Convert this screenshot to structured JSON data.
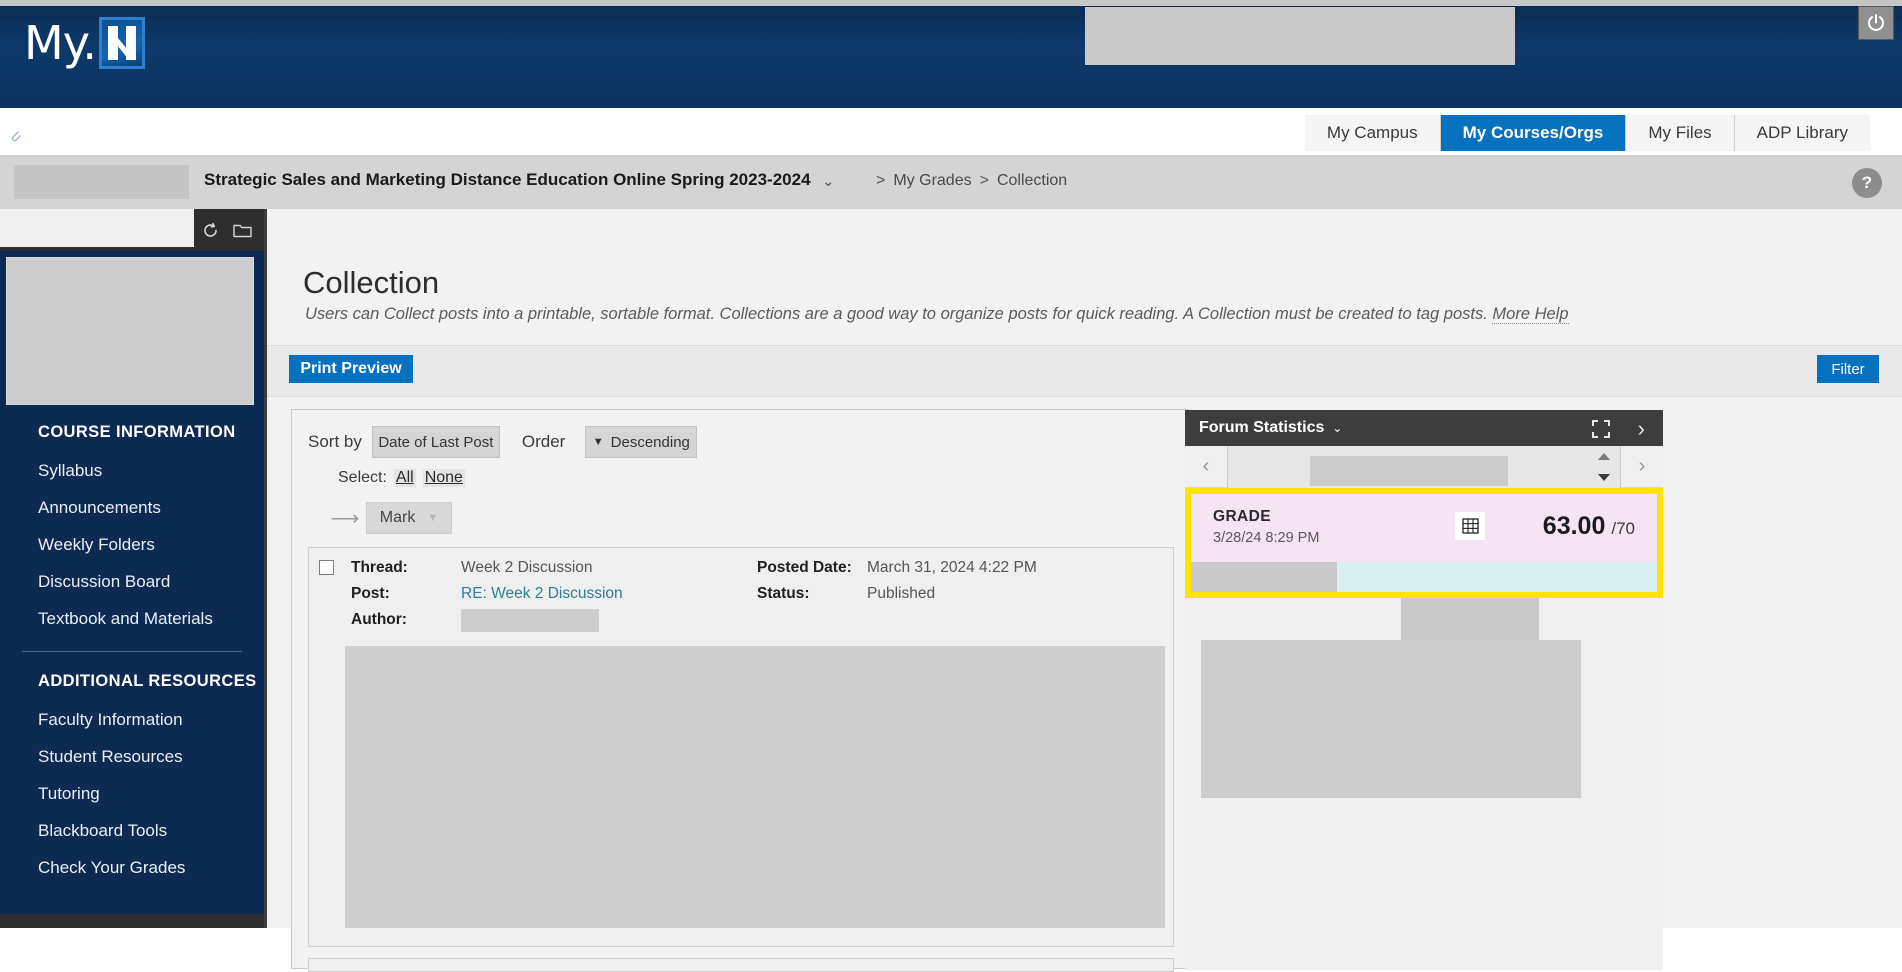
{
  "header": {
    "brand_prefix": "My.",
    "brand_mark": "N",
    "power_icon": "power-icon",
    "paperclip_icon": "paperclip-icon"
  },
  "tabs": [
    {
      "label": "My Campus",
      "active": false
    },
    {
      "label": "My Courses/Orgs",
      "active": true
    },
    {
      "label": "My Files",
      "active": false
    },
    {
      "label": "ADP Library",
      "active": false
    }
  ],
  "breadcrumb": {
    "course": "Strategic Sales and Marketing Distance Education Online Spring 2023-2024",
    "caret": "⌄",
    "separator_1": ">",
    "item_1": "My Grades",
    "separator_2": ">",
    "item_2": "Collection",
    "help_label": "?"
  },
  "sidebar": {
    "refresh_icon": "refresh-icon",
    "folder_icon": "folder-icon",
    "sections": [
      {
        "heading": "COURSE INFORMATION",
        "items": [
          "Syllabus",
          "Announcements",
          "Weekly Folders",
          "Discussion Board",
          "Textbook and Materials"
        ]
      },
      {
        "heading": "ADDITIONAL RESOURCES",
        "items": [
          "Faculty Information",
          "Student Resources",
          "Tutoring",
          "Blackboard Tools",
          "Check Your Grades"
        ]
      }
    ]
  },
  "main": {
    "title": "Collection",
    "description": "Users can Collect posts into a printable, sortable format. Collections are a good way to organize posts for quick reading. A Collection must be created to tag posts.",
    "more_help": "More Help",
    "print_preview_label": "Print Preview",
    "filter_label": "Filter"
  },
  "controls": {
    "sort_by_label": "Sort by",
    "sort_by_value": "Date of Last Post",
    "order_label": "Order",
    "order_value": "Descending",
    "order_caret": "▼",
    "select_label": "Select:",
    "select_all": "All",
    "select_none": "None",
    "mark_label": "Mark",
    "mark_caret": "▼"
  },
  "post": {
    "thread_key": "Thread:",
    "thread_value": "Week 2 Discussion",
    "post_key": "Post:",
    "post_value": "RE: Week 2 Discussion",
    "author_key": "Author:",
    "author_value": "",
    "posted_date_key": "Posted Date:",
    "posted_date_value": "March 31, 2024 4:22 PM",
    "status_key": "Status:",
    "status_value": "Published"
  },
  "right_panel": {
    "forum_stats_title": "Forum Statistics",
    "forum_stats_caret": "⌄",
    "expand_icon": "expand-icon",
    "next_icon": "chevron-right-icon",
    "prev_page_icon": "chevron-left-icon",
    "next_page_icon": "chevron-right-icon",
    "spinner_icon": "spinner-updown-icon"
  },
  "grade": {
    "label": "GRADE",
    "date": "3/28/24 8:29 PM",
    "grid_icon": "grid-icon",
    "score": "63.00",
    "denominator": "/70",
    "highlight_color": "#ffe400",
    "background_color": "#f5e4f4"
  }
}
